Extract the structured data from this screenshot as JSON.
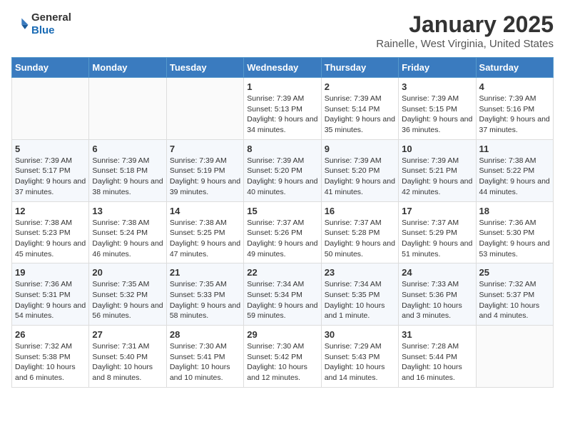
{
  "logo": {
    "general": "General",
    "blue": "Blue"
  },
  "header": {
    "month": "January 2025",
    "location": "Rainelle, West Virginia, United States"
  },
  "weekdays": [
    "Sunday",
    "Monday",
    "Tuesday",
    "Wednesday",
    "Thursday",
    "Friday",
    "Saturday"
  ],
  "weeks": [
    [
      null,
      null,
      null,
      {
        "day": "1",
        "sunrise": "7:39 AM",
        "sunset": "5:13 PM",
        "daylight": "9 hours and 34 minutes."
      },
      {
        "day": "2",
        "sunrise": "7:39 AM",
        "sunset": "5:14 PM",
        "daylight": "9 hours and 35 minutes."
      },
      {
        "day": "3",
        "sunrise": "7:39 AM",
        "sunset": "5:15 PM",
        "daylight": "9 hours and 36 minutes."
      },
      {
        "day": "4",
        "sunrise": "7:39 AM",
        "sunset": "5:16 PM",
        "daylight": "9 hours and 37 minutes."
      }
    ],
    [
      {
        "day": "5",
        "sunrise": "7:39 AM",
        "sunset": "5:17 PM",
        "daylight": "9 hours and 37 minutes."
      },
      {
        "day": "6",
        "sunrise": "7:39 AM",
        "sunset": "5:18 PM",
        "daylight": "9 hours and 38 minutes."
      },
      {
        "day": "7",
        "sunrise": "7:39 AM",
        "sunset": "5:19 PM",
        "daylight": "9 hours and 39 minutes."
      },
      {
        "day": "8",
        "sunrise": "7:39 AM",
        "sunset": "5:20 PM",
        "daylight": "9 hours and 40 minutes."
      },
      {
        "day": "9",
        "sunrise": "7:39 AM",
        "sunset": "5:20 PM",
        "daylight": "9 hours and 41 minutes."
      },
      {
        "day": "10",
        "sunrise": "7:39 AM",
        "sunset": "5:21 PM",
        "daylight": "9 hours and 42 minutes."
      },
      {
        "day": "11",
        "sunrise": "7:38 AM",
        "sunset": "5:22 PM",
        "daylight": "9 hours and 44 minutes."
      }
    ],
    [
      {
        "day": "12",
        "sunrise": "7:38 AM",
        "sunset": "5:23 PM",
        "daylight": "9 hours and 45 minutes."
      },
      {
        "day": "13",
        "sunrise": "7:38 AM",
        "sunset": "5:24 PM",
        "daylight": "9 hours and 46 minutes."
      },
      {
        "day": "14",
        "sunrise": "7:38 AM",
        "sunset": "5:25 PM",
        "daylight": "9 hours and 47 minutes."
      },
      {
        "day": "15",
        "sunrise": "7:37 AM",
        "sunset": "5:26 PM",
        "daylight": "9 hours and 49 minutes."
      },
      {
        "day": "16",
        "sunrise": "7:37 AM",
        "sunset": "5:28 PM",
        "daylight": "9 hours and 50 minutes."
      },
      {
        "day": "17",
        "sunrise": "7:37 AM",
        "sunset": "5:29 PM",
        "daylight": "9 hours and 51 minutes."
      },
      {
        "day": "18",
        "sunrise": "7:36 AM",
        "sunset": "5:30 PM",
        "daylight": "9 hours and 53 minutes."
      }
    ],
    [
      {
        "day": "19",
        "sunrise": "7:36 AM",
        "sunset": "5:31 PM",
        "daylight": "9 hours and 54 minutes."
      },
      {
        "day": "20",
        "sunrise": "7:35 AM",
        "sunset": "5:32 PM",
        "daylight": "9 hours and 56 minutes."
      },
      {
        "day": "21",
        "sunrise": "7:35 AM",
        "sunset": "5:33 PM",
        "daylight": "9 hours and 58 minutes."
      },
      {
        "day": "22",
        "sunrise": "7:34 AM",
        "sunset": "5:34 PM",
        "daylight": "9 hours and 59 minutes."
      },
      {
        "day": "23",
        "sunrise": "7:34 AM",
        "sunset": "5:35 PM",
        "daylight": "10 hours and 1 minute."
      },
      {
        "day": "24",
        "sunrise": "7:33 AM",
        "sunset": "5:36 PM",
        "daylight": "10 hours and 3 minutes."
      },
      {
        "day": "25",
        "sunrise": "7:32 AM",
        "sunset": "5:37 PM",
        "daylight": "10 hours and 4 minutes."
      }
    ],
    [
      {
        "day": "26",
        "sunrise": "7:32 AM",
        "sunset": "5:38 PM",
        "daylight": "10 hours and 6 minutes."
      },
      {
        "day": "27",
        "sunrise": "7:31 AM",
        "sunset": "5:40 PM",
        "daylight": "10 hours and 8 minutes."
      },
      {
        "day": "28",
        "sunrise": "7:30 AM",
        "sunset": "5:41 PM",
        "daylight": "10 hours and 10 minutes."
      },
      {
        "day": "29",
        "sunrise": "7:30 AM",
        "sunset": "5:42 PM",
        "daylight": "10 hours and 12 minutes."
      },
      {
        "day": "30",
        "sunrise": "7:29 AM",
        "sunset": "5:43 PM",
        "daylight": "10 hours and 14 minutes."
      },
      {
        "day": "31",
        "sunrise": "7:28 AM",
        "sunset": "5:44 PM",
        "daylight": "10 hours and 16 minutes."
      },
      null
    ]
  ]
}
